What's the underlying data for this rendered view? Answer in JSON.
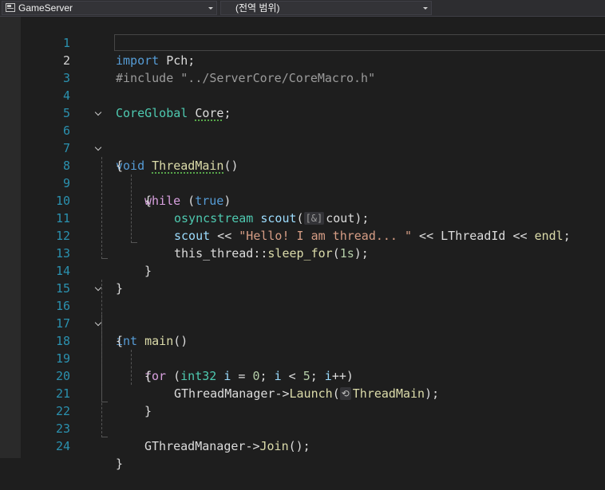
{
  "navbar": {
    "project": "GameServer",
    "scope": "(전역 범위)"
  },
  "editor": {
    "current_line": 2,
    "lines": [
      {
        "n": "1"
      },
      {
        "n": "2"
      },
      {
        "n": "3"
      },
      {
        "n": "4"
      },
      {
        "n": "5"
      },
      {
        "n": "6"
      },
      {
        "n": "7"
      },
      {
        "n": "8"
      },
      {
        "n": "9"
      },
      {
        "n": "10"
      },
      {
        "n": "11"
      },
      {
        "n": "12"
      },
      {
        "n": "13"
      },
      {
        "n": "14"
      },
      {
        "n": "15"
      },
      {
        "n": "16"
      },
      {
        "n": "17"
      },
      {
        "n": "18"
      },
      {
        "n": "19"
      },
      {
        "n": "20"
      },
      {
        "n": "21"
      },
      {
        "n": "22"
      },
      {
        "n": "23"
      },
      {
        "n": "24"
      }
    ],
    "tokens": {
      "l1_kw": "import",
      "l1_rest": " Pch;",
      "l2_dir": "#include",
      "l2_path": "\"../ServerCore/CoreMacro.h\"",
      "l4_type": "CoreGlobal",
      "l4_var": "Core",
      "l4_semi": ";",
      "l6_kw": "void",
      "l6_fn": "ThreadMain",
      "l6_rest": "()",
      "brace_open": "{",
      "brace_close": "}",
      "l8_kw": "while",
      "l8_open": " (",
      "l8_true": "true",
      "l8_close": ")",
      "l10_type": "osyncstream",
      "l10_var": "scout",
      "l10_paren": "(",
      "l10_hint": "[&]",
      "l10_rest": "cout);",
      "l11_var": "scout",
      "l11_op1": " << ",
      "l11_str": "\"Hello! I am thread... \"",
      "l11_op2": " << ",
      "l11_id": "LThreadId",
      "l11_op3": " << ",
      "l11_endl": "endl",
      "l11_semi": ";",
      "l12_ns": "this_thread",
      "l12_sep": "::",
      "l12_fn": "sleep_for",
      "l12_p1": "(",
      "l12_num": "1s",
      "l12_p2": ");",
      "l16_kw": "int",
      "l16_fn": "main",
      "l16_rest": "()",
      "l18_kw": "for",
      "l18_p": " (",
      "l18_type": "int32",
      "l18_i": "i",
      "l18_eq": " = ",
      "l18_zero": "0",
      "l18_semi1": "; ",
      "l18_i2": "i",
      "l18_lt": " < ",
      "l18_five": "5",
      "l18_semi2": "; ",
      "l18_i3": "i",
      "l18_inc": "++)",
      "l20_obj": "GThreadManager",
      "l20_arrow": "->",
      "l20_fn": "Launch",
      "l20_paren": "(",
      "l20_hint_icon": "⟲",
      "l20_arg": "ThreadMain",
      "l20_end": ");",
      "l23_obj": "GThreadManager",
      "l23_arrow": "->",
      "l23_fn": "Join",
      "l23_end": "();"
    }
  }
}
